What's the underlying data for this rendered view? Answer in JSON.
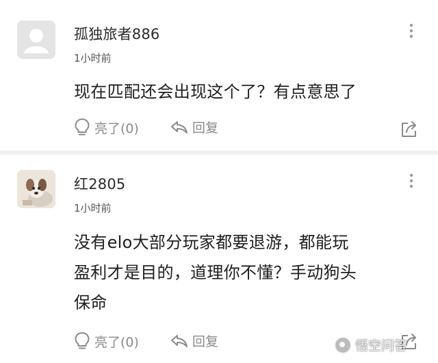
{
  "comments": [
    {
      "username": "孤独旅者886",
      "time": "1小时前",
      "content_lines": [
        "现在匹配还会出现这个了？有点意思了"
      ],
      "like_label": "亮了(0)",
      "reply_label": "回复",
      "avatar_icon": "default-user-icon"
    },
    {
      "username": "红2805",
      "time": "1小时前",
      "content_lines": [
        "没有elo大部分玩家都要退游，都能玩",
        "盈利才是目的，道理你不懂？手动狗头",
        "保命"
      ],
      "like_label": "亮了(0)",
      "reply_label": "回复",
      "avatar_icon": "dog-photo-avatar"
    }
  ],
  "icons": {
    "more": "more-vertical-icon",
    "like": "lightbulb-icon",
    "reply": "reply-arrow-icon",
    "share": "share-icon"
  },
  "watermark": {
    "text": "悟空问答"
  },
  "colors": {
    "text": "#1e1e1e",
    "muted": "#8a8a8a",
    "divider": "#f3f3f3"
  }
}
